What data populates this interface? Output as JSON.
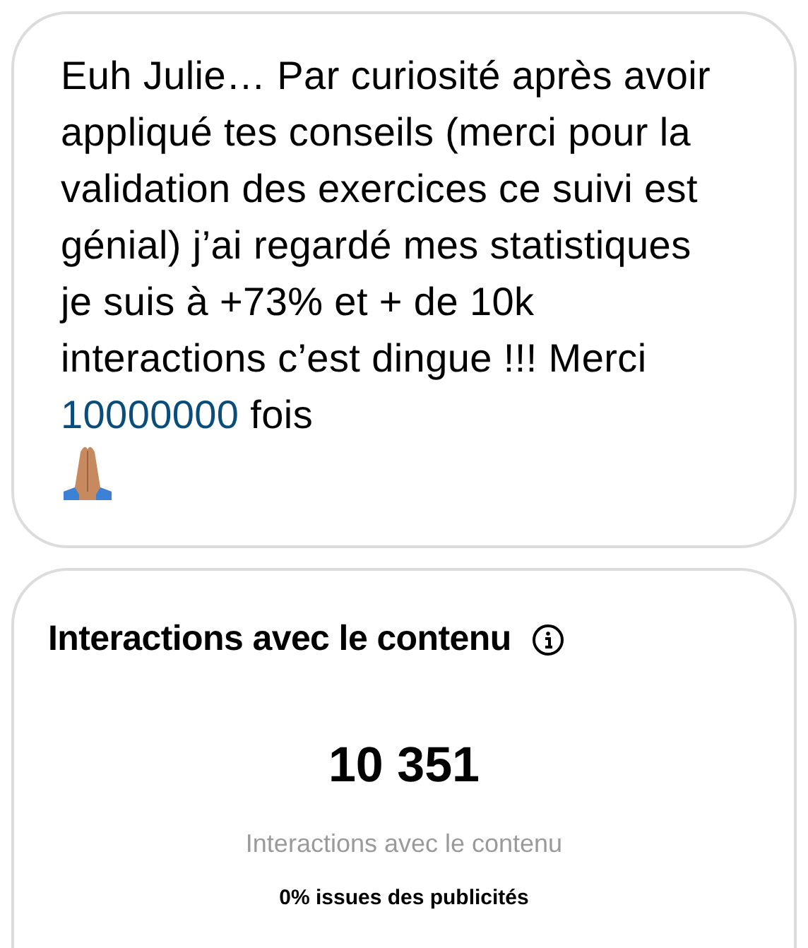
{
  "message": {
    "text_before": "Euh Julie… Par curiosité après avoir appliqué tes conseils (merci pour la validation des exercices ce suivi est génial) j’ai regardé mes statistiques je suis à +73% et + de 10k interactions c’est dingue !!! Merci ",
    "link": "10000000",
    "text_after": " fois"
  },
  "card": {
    "title": "Interactions avec le contenu",
    "value": "10 351",
    "caption": "Interactions avec le contenu",
    "note": "0% issues des publicités"
  }
}
